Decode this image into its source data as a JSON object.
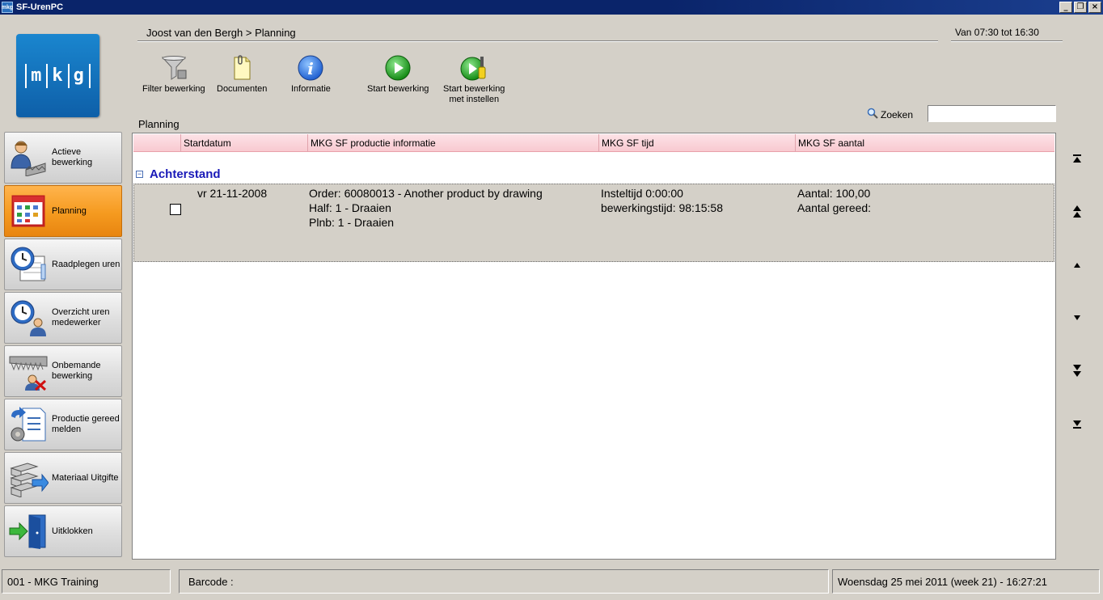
{
  "window": {
    "title": "SF-UrenPC",
    "app_icon": "mkg"
  },
  "logo": {
    "letters": [
      "m",
      "k",
      "g"
    ]
  },
  "breadcrumb": "Joost van den Bergh > Planning",
  "work_hours": "Van 07:30 tot 16:30",
  "toolbar": [
    {
      "label": "Filter bewerking",
      "icon": "filter-icon"
    },
    {
      "label": "Documenten",
      "icon": "documents-icon"
    },
    {
      "label": "Informatie",
      "icon": "info-icon"
    },
    {
      "label": "Start bewerking",
      "icon": "play-icon"
    },
    {
      "label_line1": "Start bewerking",
      "label_line2": "met instellen",
      "icon": "play-setup-icon"
    }
  ],
  "search": {
    "label": "Zoeken",
    "value": ""
  },
  "section_title": "Planning",
  "sidebar": {
    "items": [
      {
        "label": "Actieve bewerking",
        "icon": "worker-icon",
        "active": false
      },
      {
        "label": "Planning",
        "icon": "calendar-icon",
        "active": true
      },
      {
        "label": "Raadplegen uren",
        "icon": "clock-icon",
        "active": false
      },
      {
        "label": "Overzicht uren medewerker",
        "icon": "clock-person-icon",
        "active": false
      },
      {
        "label": "Onbemande bewerking",
        "icon": "unmanned-icon",
        "active": false
      },
      {
        "label": "Productie gereed melden",
        "icon": "production-ready-icon",
        "active": false
      },
      {
        "label": "Materiaal Uitgifte",
        "icon": "material-icon",
        "active": false
      },
      {
        "label": "Uitklokken",
        "icon": "door-exit-icon",
        "active": false
      }
    ]
  },
  "grid": {
    "columns": [
      "Startdatum",
      "MKG SF productie informatie",
      "MKG SF tijd",
      "MKG SF aantal"
    ],
    "group": {
      "title": "Achterstand",
      "toggle": "−"
    },
    "rows": [
      {
        "checked": false,
        "startdatum": "vr 21-11-2008",
        "info": [
          "Order: 60080013 - Another product by drawing",
          "Half: 1 - Draaien",
          "Plnb: 1 - Draaien"
        ],
        "tijd": [
          "Insteltijd 0:00:00",
          "bewerkingstijd: 98:15:58"
        ],
        "aantal": [
          "Aantal: 100,00",
          "Aantal gereed:"
        ]
      }
    ]
  },
  "nav_buttons": [
    "first-icon",
    "page-up-icon",
    "up-icon",
    "down-icon",
    "page-down-icon",
    "last-icon"
  ],
  "statusbar": {
    "company": "001 - MKG Training",
    "barcode_label": "Barcode :",
    "datetime": "Woensdag 25 mei 2011 (week 21)  -  16:27:21"
  },
  "colors": {
    "titlebar": "#0a246a",
    "active_nav": "#f59a1f",
    "group_title": "#1a1ab8",
    "grid_header": "#f8c9d0"
  }
}
